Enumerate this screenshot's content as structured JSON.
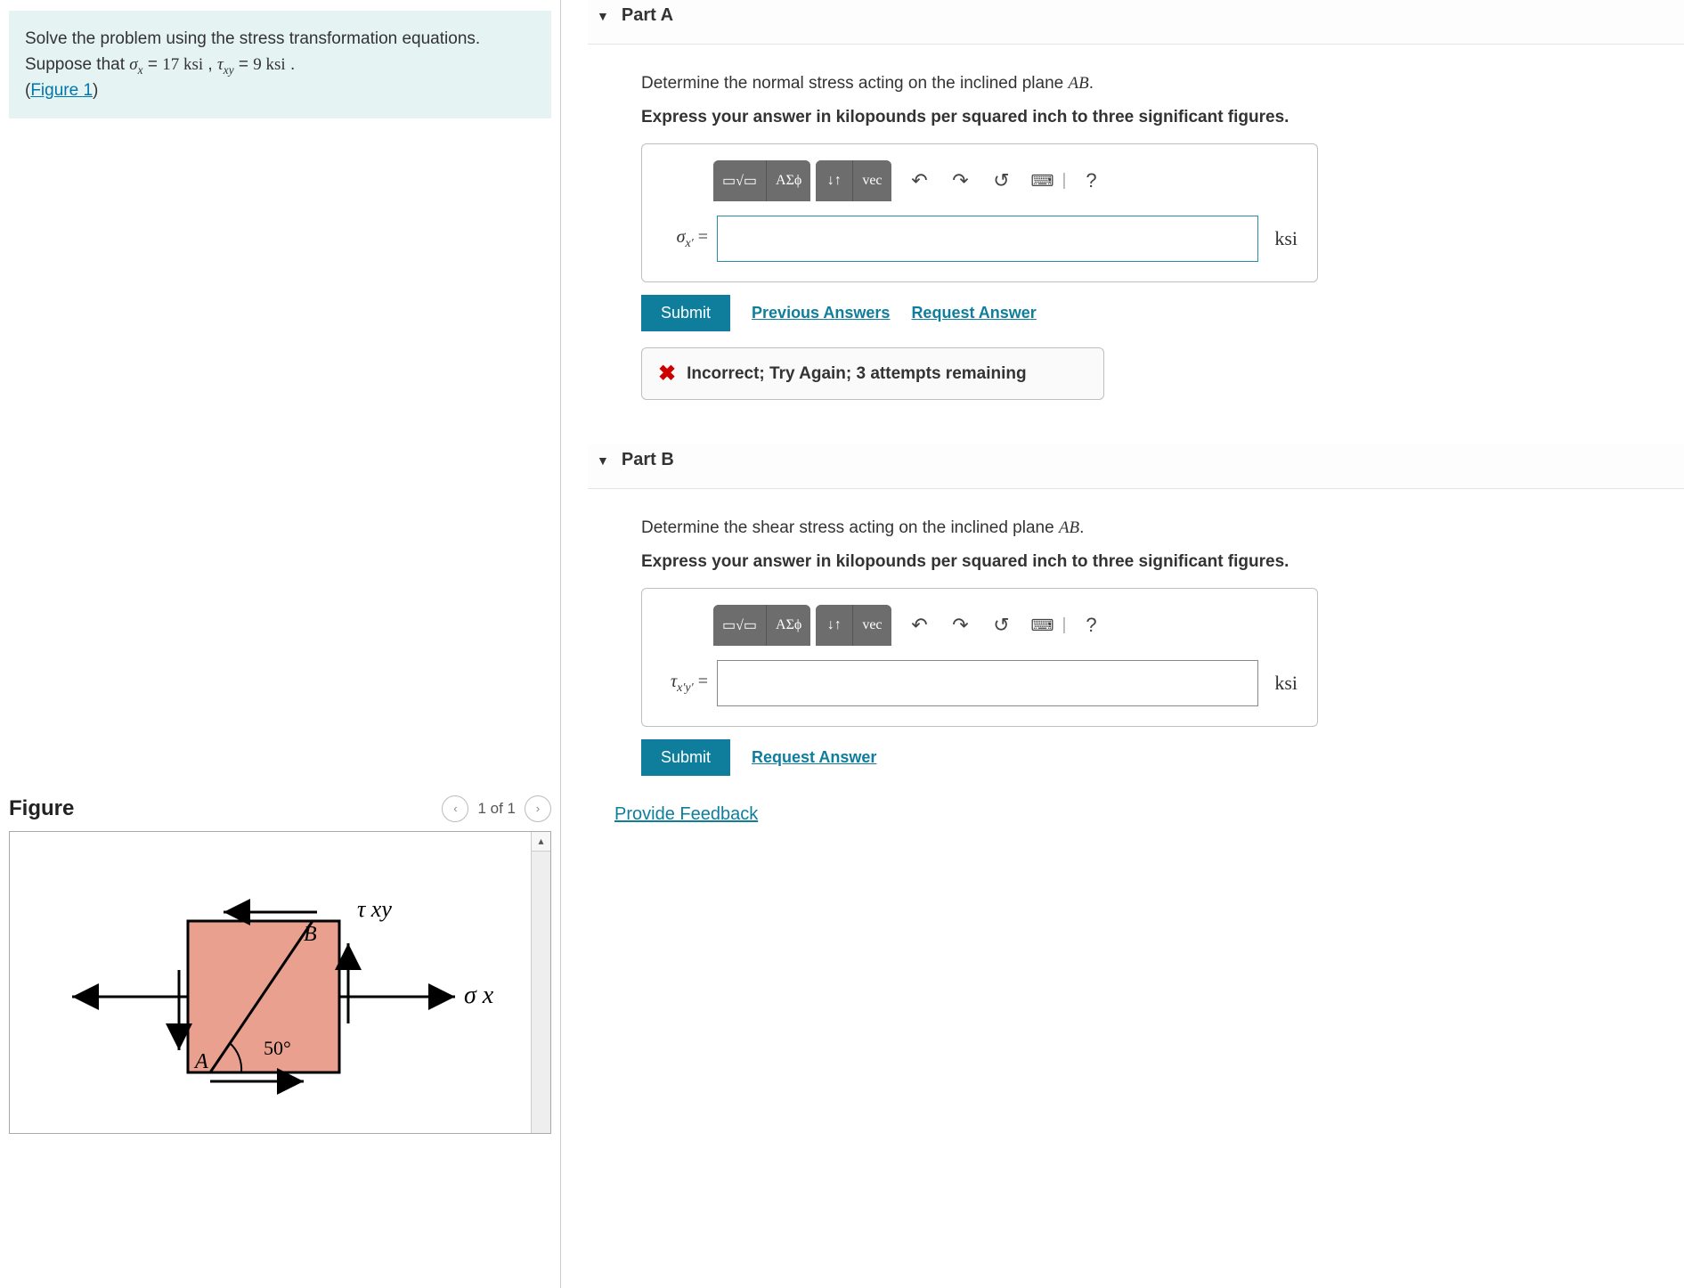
{
  "problem": {
    "line1_prefix": "Solve the problem using the stress transformation equations. Suppose that ",
    "sigma_var": "σ",
    "sigma_sub": "x",
    "equals": " = ",
    "sigma_val": "17 ksi",
    "sep": ", ",
    "tau_var": "τ",
    "tau_sub": "xy",
    "tau_val": "9 ksi",
    "period": ".",
    "figure_link": "Figure 1"
  },
  "figure": {
    "title": "Figure",
    "counter": "1 of 1",
    "labels": {
      "tau_xy": "τ xy",
      "sigma_x": "σ x",
      "A": "A",
      "B": "B",
      "angle": "50°"
    }
  },
  "partA": {
    "title": "Part A",
    "question_prefix": "Determine the normal stress acting on the inclined plane ",
    "plane": "AB",
    "question_suffix": ".",
    "instruct": "Express your answer in kilopounds per squared inch to three significant figures.",
    "var_label": "σx′ =",
    "unit": "ksi",
    "value": "",
    "submit": "Submit",
    "prev_answers": "Previous Answers",
    "request": "Request Answer",
    "feedback": "Incorrect; Try Again; 3 attempts remaining"
  },
  "partB": {
    "title": "Part B",
    "question_prefix": "Determine the shear stress acting on the inclined plane ",
    "plane": "AB",
    "question_suffix": ".",
    "instruct": "Express your answer in kilopounds per squared inch to three significant figures.",
    "var_label": "τx′y′ =",
    "unit": "ksi",
    "value": "",
    "submit": "Submit",
    "request": "Request Answer"
  },
  "toolbar": {
    "templates": "▭√▭",
    "greek": "ΑΣϕ",
    "arrows": "↓↑",
    "vec": "vec",
    "undo": "↶",
    "redo": "↷",
    "reset": "↺",
    "keyboard": "⌨",
    "help": "?"
  },
  "footer": {
    "feedback": "Provide Feedback"
  }
}
